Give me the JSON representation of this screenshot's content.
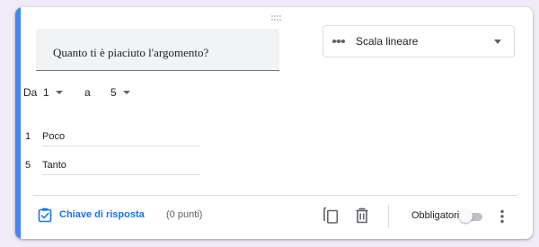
{
  "question": {
    "title": "Quanto ti è piaciuto l'argomento?"
  },
  "type_select": {
    "icon": "linear-scale-icon",
    "label": "Scala lineare"
  },
  "scale": {
    "from_label": "Da",
    "from_value": "1",
    "to_label": "a",
    "to_value": "5"
  },
  "scale_labels": [
    {
      "number": "1",
      "text": "Poco"
    },
    {
      "number": "5",
      "text": "Tanto"
    }
  ],
  "footer": {
    "answer_key_label": "Chiave di risposta",
    "points_label": "(0 punti)",
    "required_label": "Obbligatorio",
    "required_on": false
  },
  "colors": {
    "accent": "#4285f4",
    "link": "#1a73e8",
    "background": "#f0ebf8"
  }
}
